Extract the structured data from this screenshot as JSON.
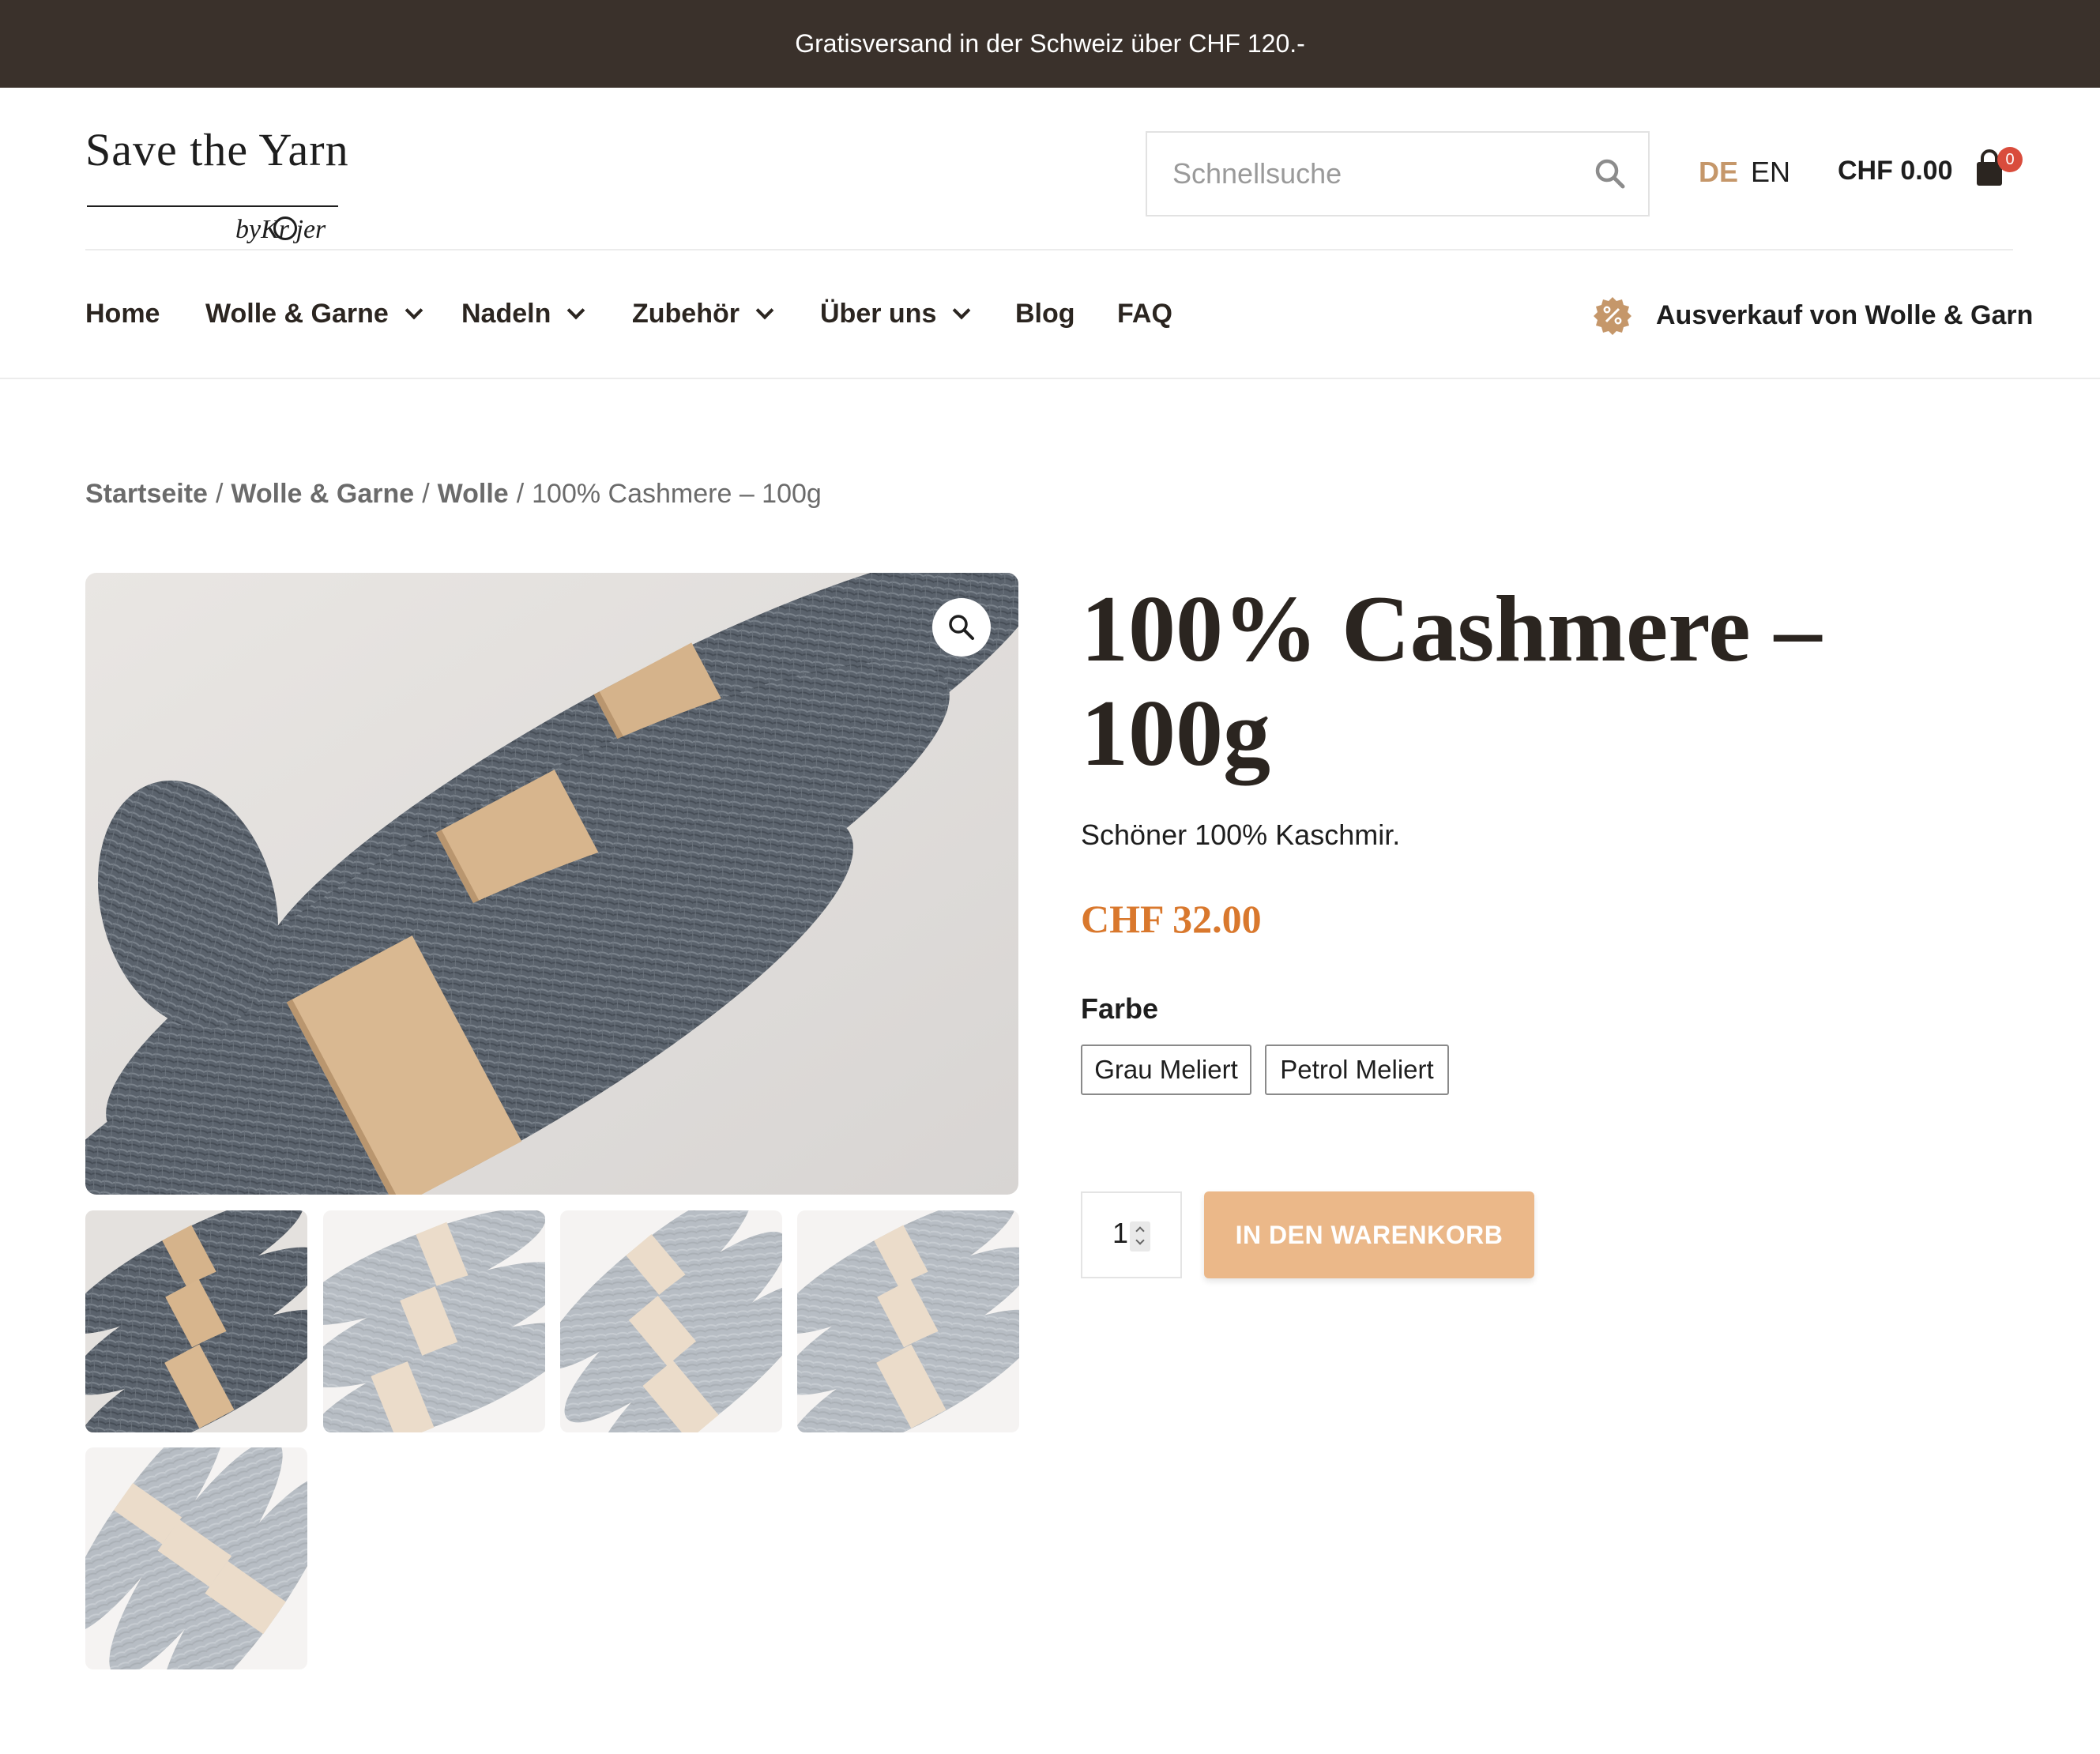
{
  "announcement": "Gratisversand in der Schweiz über CHF 120.-",
  "logo": {
    "line1": "Save the Yarn",
    "line2": "byKr  jer"
  },
  "search": {
    "placeholder": "Schnellsuche"
  },
  "languages": {
    "active": "DE",
    "other": "EN"
  },
  "cart": {
    "total": "CHF 0.00",
    "count": "0"
  },
  "nav": {
    "items": [
      {
        "label": "Home",
        "has_dropdown": false
      },
      {
        "label": "Wolle & Garne",
        "has_dropdown": true
      },
      {
        "label": "Nadeln",
        "has_dropdown": true
      },
      {
        "label": "Zubehör",
        "has_dropdown": true
      },
      {
        "label": "Über uns",
        "has_dropdown": true
      },
      {
        "label": "Blog",
        "has_dropdown": false
      },
      {
        "label": "FAQ",
        "has_dropdown": false
      }
    ],
    "sale_label": "Ausverkauf von Wolle & Garn"
  },
  "breadcrumb": {
    "items": [
      "Startseite",
      "Wolle & Garne",
      "Wolle"
    ],
    "current": "100% Cashmere – 100g",
    "separator": "/"
  },
  "product": {
    "title": "100% Cashmere – 100g",
    "description": "Schöner 100% Kaschmir.",
    "price": "CHF 32.00",
    "attribute_label": "Farbe",
    "options": [
      "Grau Meliert",
      "Petrol Meliert"
    ],
    "quantity": "1",
    "add_to_cart": "IN DEN WARENKORB"
  },
  "gallery": {
    "thumbnail_count": 5,
    "active_thumbnail": 1
  },
  "colors": {
    "topbar": "#3a312b",
    "accent": "#c5976a",
    "price": "#d9782d",
    "button": "#ebb889",
    "badge": "#d94c3c"
  }
}
